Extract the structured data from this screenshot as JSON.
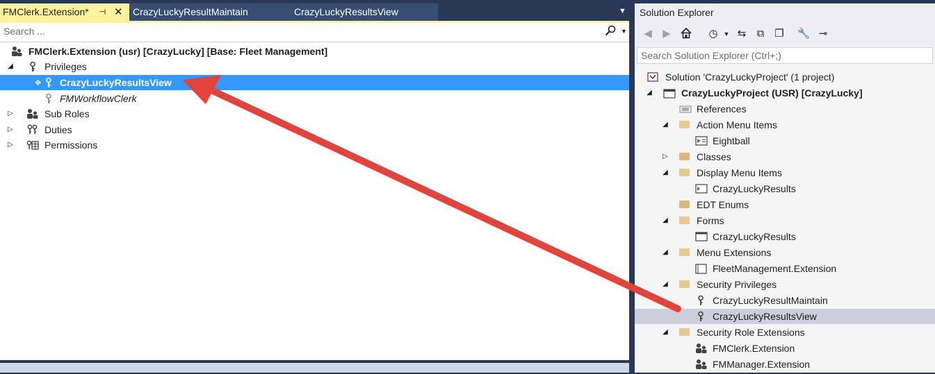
{
  "designer": {
    "tabs": [
      {
        "label": "FMClerk.Extension*",
        "pin": "⊓",
        "close": "✕"
      },
      {
        "label": "CrazyLuckyResultMaintain"
      },
      {
        "label": "CrazyLuckyResultsView"
      }
    ],
    "search": {
      "placeholder": "Search ...",
      "icon": "search-icon"
    },
    "tree": {
      "root": "FMClerk.Extension (usr) [CrazyLucky] [Base: Fleet Management]",
      "privileges": "Privileges",
      "priv_items": [
        "CrazyLuckyResultsView",
        "FMWorkflowClerk"
      ],
      "sub_roles": "Sub Roles",
      "duties": "Duties",
      "permissions": "Permissions"
    }
  },
  "solution_explorer": {
    "title": "Solution Explorer",
    "search_placeholder": "Search Solution Explorer (Ctrl+;)",
    "solution": "Solution 'CrazyLuckyProject' (1 project)",
    "project": "CrazyLuckyProject (USR) [CrazyLucky]",
    "nodes": {
      "references": "References",
      "action_menu_items": "Action Menu Items",
      "eightball": "Eightball",
      "classes": "Classes",
      "display_menu_items": "Display Menu Items",
      "crazy_lucky_results_dmi": "CrazyLuckyResults",
      "edt_enums": "EDT Enums",
      "forms": "Forms",
      "crazy_lucky_results_form": "CrazyLuckyResults",
      "menu_extensions": "Menu Extensions",
      "fleet_mgmt_ext": "FleetManagement.Extension",
      "security_privileges": "Security Privileges",
      "priv_maintain": "CrazyLuckyResultMaintain",
      "priv_view": "CrazyLuckyResultsView",
      "security_role_extensions": "Security Role Extensions",
      "fmclerk_ext": "FMClerk.Extension",
      "fmmanager_ext": "FMManager.Extension"
    }
  },
  "colors": {
    "selection": "#3399ff",
    "active_tab": "#fff29d",
    "arrow": "#e2443c",
    "frame": "#293955"
  }
}
